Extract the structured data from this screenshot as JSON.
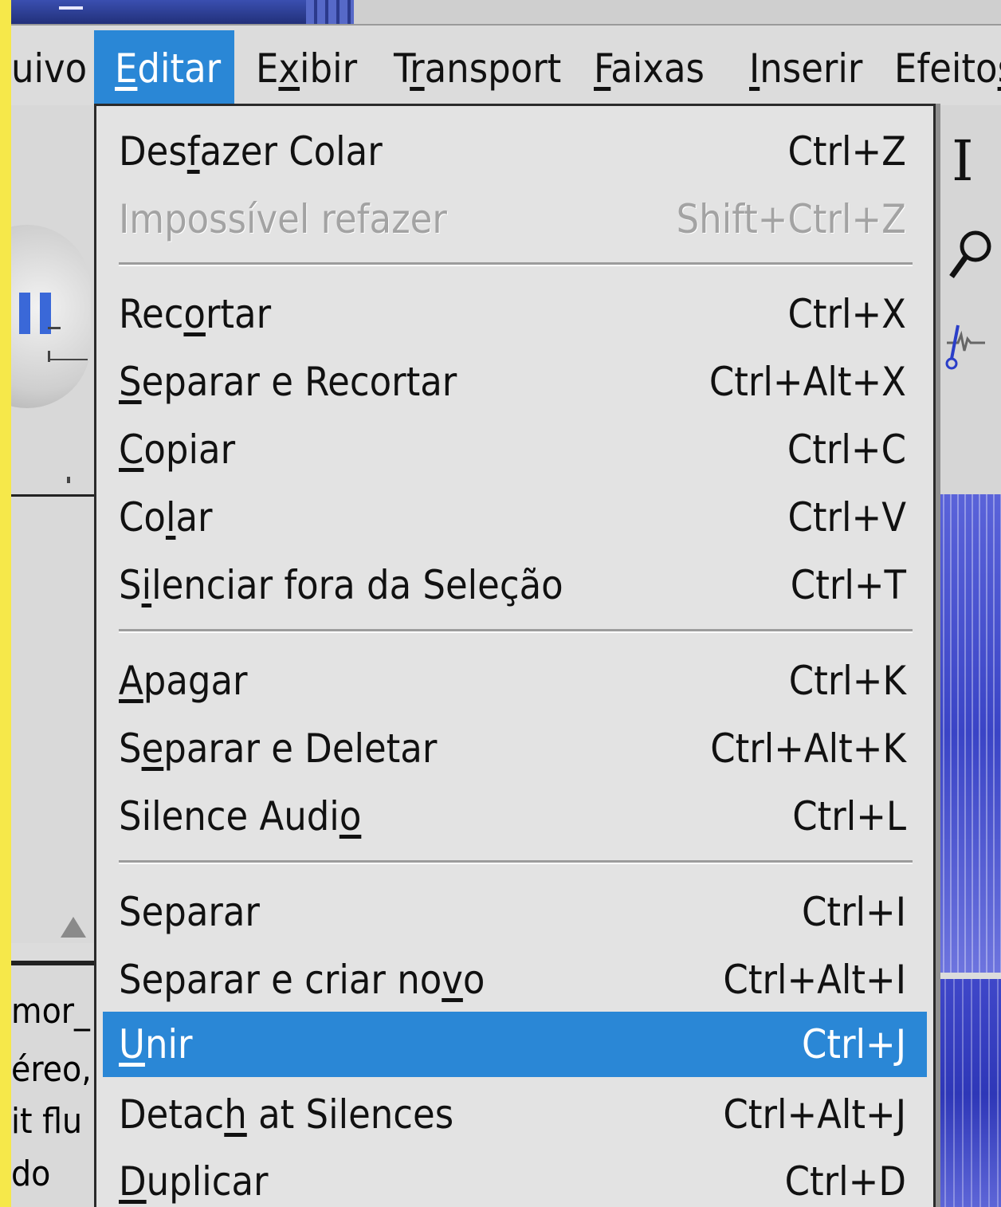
{
  "menubar": {
    "items": [
      {
        "pre": "uivo",
        "mn": "",
        "post": ""
      },
      {
        "pre": "",
        "mn": "E",
        "post": "ditar"
      },
      {
        "pre": "E",
        "mn": "x",
        "post": "ibir"
      },
      {
        "pre": "T",
        "mn": "r",
        "post": "ansport"
      },
      {
        "pre": "",
        "mn": "F",
        "post": "aixas"
      },
      {
        "pre": "",
        "mn": "I",
        "post": "nserir"
      },
      {
        "pre": "Efeito",
        "mn": "s",
        "post": ""
      }
    ]
  },
  "edit_menu": {
    "items": [
      {
        "pre": "Des",
        "mn": "f",
        "post": "azer Colar",
        "shortcut": "Ctrl+Z"
      },
      {
        "pre": "Impossível refazer",
        "mn": "",
        "post": "",
        "shortcut": "Shift+Ctrl+Z"
      },
      {
        "pre": "Rec",
        "mn": "o",
        "post": "rtar",
        "shortcut": "Ctrl+X"
      },
      {
        "pre": "",
        "mn": "S",
        "post": "eparar e Recortar",
        "shortcut": "Ctrl+Alt+X"
      },
      {
        "pre": "",
        "mn": "C",
        "post": "opiar",
        "shortcut": "Ctrl+C"
      },
      {
        "pre": "Co",
        "mn": "l",
        "post": "ar",
        "shortcut": "Ctrl+V"
      },
      {
        "pre": "S",
        "mn": "i",
        "post": "lenciar fora da Seleção",
        "shortcut": "Ctrl+T"
      },
      {
        "pre": "",
        "mn": "A",
        "post": "pagar",
        "shortcut": "Ctrl+K"
      },
      {
        "pre": "S",
        "mn": "e",
        "post": "parar e Deletar",
        "shortcut": "Ctrl+Alt+K"
      },
      {
        "pre": "Silence Audi",
        "mn": "o",
        "post": "",
        "shortcut": "Ctrl+L"
      },
      {
        "pre": "Separar",
        "mn": "",
        "post": "",
        "shortcut": "Ctrl+I"
      },
      {
        "pre": "Separar e criar no",
        "mn": "v",
        "post": "o",
        "shortcut": "Ctrl+Alt+I"
      },
      {
        "pre": "",
        "mn": "U",
        "post": "nir",
        "shortcut": "Ctrl+J"
      },
      {
        "pre": "Detac",
        "mn": "h",
        "post": " at Silences",
        "shortcut": "Ctrl+Alt+J"
      },
      {
        "pre": "",
        "mn": "D",
        "post": "uplicar",
        "shortcut": "Ctrl+D"
      }
    ]
  },
  "track_info": {
    "name": "mor_",
    "line1": "éreo,",
    "line2": "it flu",
    "line3": "do"
  },
  "colors": {
    "highlight": "#2a87d6",
    "waveform": "#3a44c6",
    "frame": "#f6e84a"
  }
}
